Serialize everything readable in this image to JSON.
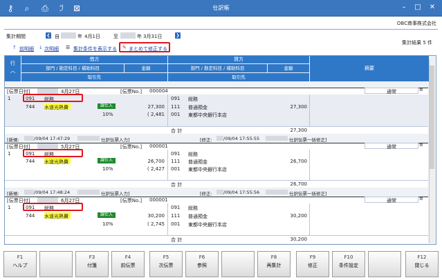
{
  "window": {
    "title": "仕訳帳"
  },
  "toolbar": {
    "icons": [
      "key-plus-icon",
      "zoom-icon",
      "printer-icon",
      "pdf-icon",
      "excel-icon"
    ]
  },
  "company": "OBC商事株式会社",
  "period": {
    "label": "集計期間",
    "from": "4月1日",
    "to": "3月31日",
    "from_prefix": "自",
    "to_prefix": "至",
    "year_suffix": "年"
  },
  "links": {
    "prev": "前明細",
    "next": "次明細",
    "show_cond": "集計条件を表示する",
    "bulk_edit": "まとめて修正する"
  },
  "result": "集計結果 5 件",
  "header": {
    "row": "行",
    "debit": "借方",
    "credit": "貸方",
    "summary": "摘要",
    "dept_acct": "部門 / 勘定科目 / 補助科目",
    "amount": "金額",
    "partner": "取引先"
  },
  "records": [
    {
      "date_label": "[伝票日付]",
      "date": "4月27日",
      "no_label": "[伝票No.]",
      "no": "000004",
      "status": "通常",
      "line": "1",
      "d_dept": "091",
      "d_dept_name": "総務",
      "d_acct": "744",
      "d_acct_name": "水道光熱費",
      "tax_tag": "課仕入",
      "d_amount": "27,300",
      "d_tax": "( 2,481",
      "tax_rate": "10%",
      "c_dept": "091",
      "c_dept_name": "総務",
      "c_acct": "111",
      "c_acct_name": "普通預金",
      "c_sub": "001",
      "c_sub_name": "東都中央銀行本店",
      "c_amount": "27,300",
      "total_label": "合 計",
      "total": "27,300",
      "new_info": "[新規:",
      "new_time": "/09/04 17:47:29",
      "new_src": "仕訳伝票入力]",
      "mod_info": "[修正:",
      "mod_time": "/09/04 17:55:55",
      "mod_src": "仕訳伝票一括修正]"
    },
    {
      "date_label": "[伝票日付]",
      "date": "5月27日",
      "no_label": "[伝票No.]",
      "no": "000001",
      "status": "通常",
      "line": "1",
      "d_dept": "091",
      "d_dept_name": "総務",
      "d_acct": "744",
      "d_acct_name": "水道光熱費",
      "tax_tag": "課仕入",
      "d_amount": "26,700",
      "d_tax": "( 2,427",
      "tax_rate": "10%",
      "c_dept": "091",
      "c_dept_name": "総務",
      "c_acct": "111",
      "c_acct_name": "普通預金",
      "c_sub": "001",
      "c_sub_name": "東都中央銀行本店",
      "c_amount": "26,700",
      "total_label": "合 計",
      "total": "26,700",
      "new_info": "[新規:",
      "new_time": "/09/04 17:48:24",
      "new_src": "仕訳伝票入力]",
      "mod_info": "[修正:",
      "mod_time": "/09/04 17:55:56",
      "mod_src": "仕訳伝票一括修正]"
    },
    {
      "date_label": "[伝票日付]",
      "date": "6月27日",
      "no_label": "[伝票No.]",
      "no": "000001",
      "status": "通常",
      "line": "1",
      "d_dept": "091",
      "d_dept_name": "総務",
      "d_acct": "744",
      "d_acct_name": "水道光熱費",
      "tax_tag": "課仕入",
      "d_amount": "30,200",
      "d_tax": "( 2,745",
      "tax_rate": "10%",
      "c_dept": "091",
      "c_dept_name": "総務",
      "c_acct": "111",
      "c_acct_name": "普通預金",
      "c_sub": "001",
      "c_sub_name": "東都中央銀行本店",
      "c_amount": "30,200",
      "total_label": "合 計",
      "total": "30,200"
    }
  ],
  "fkeys": [
    {
      "key": "F1",
      "label": "ヘルプ"
    },
    {
      "key": "",
      "label": ""
    },
    {
      "key": "F3",
      "label": "付箋"
    },
    {
      "key": "F4",
      "label": "前伝票"
    },
    {
      "key": "F5",
      "label": "次伝票"
    },
    {
      "key": "F6",
      "label": "参照"
    },
    {
      "key": "",
      "label": ""
    },
    {
      "key": "F8",
      "label": "再集計"
    },
    {
      "key": "F9",
      "label": "修正"
    },
    {
      "key": "F10",
      "label": "条件設定"
    },
    {
      "key": "",
      "label": ""
    },
    {
      "key": "F12",
      "label": "閉じる"
    }
  ]
}
